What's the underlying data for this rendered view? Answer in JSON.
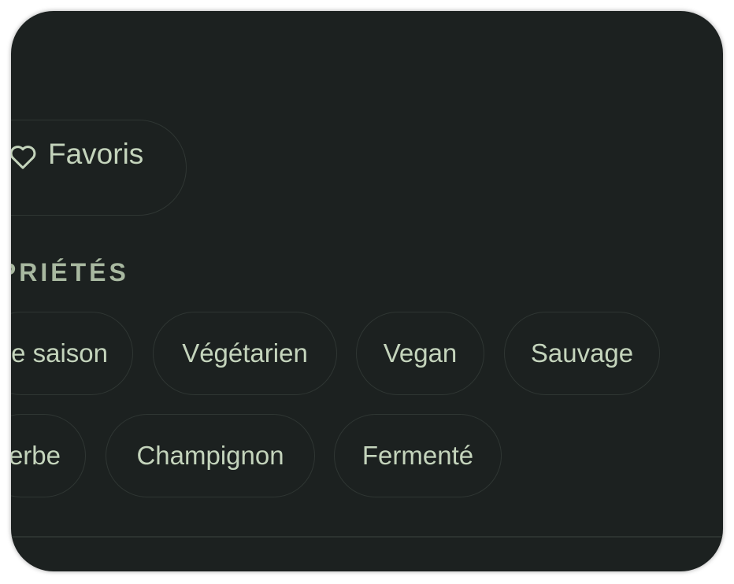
{
  "favorites": {
    "label": "Favoris",
    "icon": "heart-outline-icon"
  },
  "properties": {
    "title": "OPRIÉTÉS",
    "row1": [
      "e saison",
      "Végétarien",
      "Vegan",
      "Sauvage"
    ],
    "row2": [
      "erbe",
      "Champignon",
      "Fermenté"
    ]
  },
  "colors": {
    "background": "#1c2120",
    "chip_text": "#c4d4bc",
    "chip_border": "#2f3633",
    "section_title": "#a8b8a0"
  }
}
